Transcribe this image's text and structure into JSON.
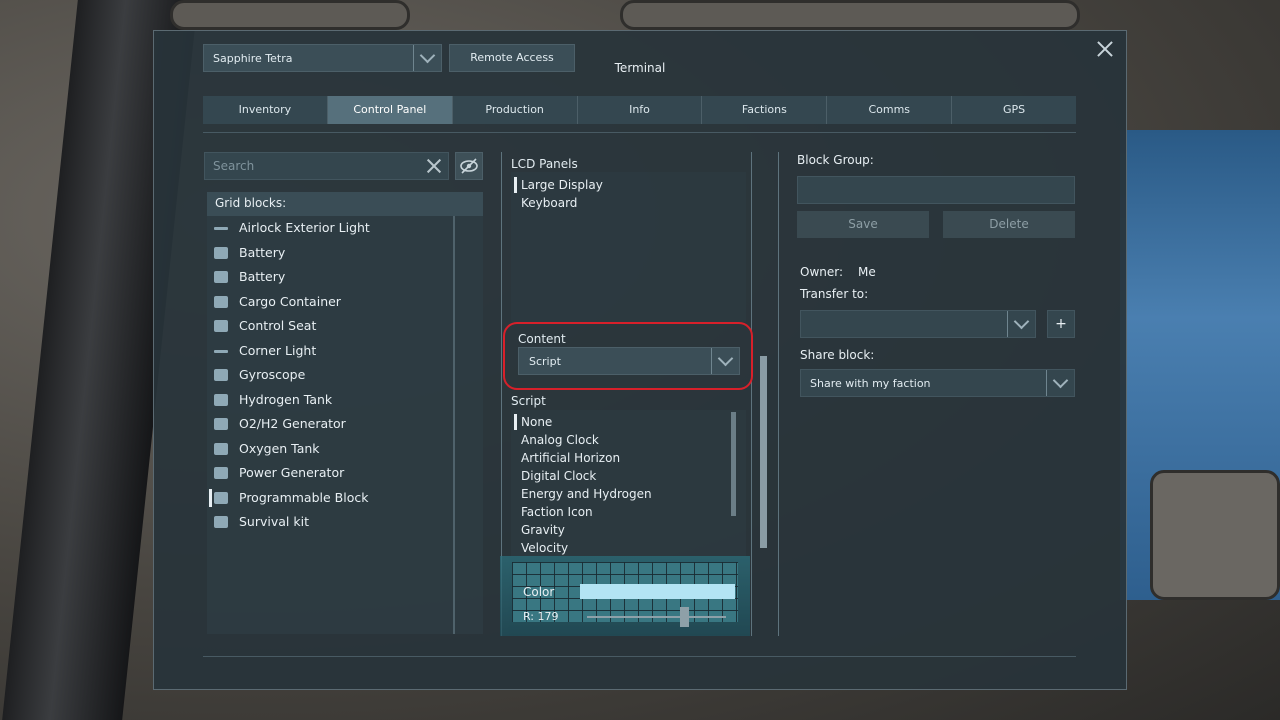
{
  "window": {
    "title": "Terminal",
    "ship_name": "Sapphire Tetra",
    "remote_access_label": "Remote Access"
  },
  "tabs": [
    {
      "label": "Inventory",
      "active": false
    },
    {
      "label": "Control Panel",
      "active": true
    },
    {
      "label": "Production",
      "active": false
    },
    {
      "label": "Info",
      "active": false
    },
    {
      "label": "Factions",
      "active": false
    },
    {
      "label": "Comms",
      "active": false
    },
    {
      "label": "GPS",
      "active": false
    }
  ],
  "left_panel": {
    "search_placeholder": "Search",
    "grid_blocks_header": "Grid blocks:",
    "items": [
      {
        "label": "Airlock Exterior Light",
        "icon": "light-strip-icon"
      },
      {
        "label": "Battery",
        "icon": "battery-icon"
      },
      {
        "label": "Battery",
        "icon": "battery-icon"
      },
      {
        "label": "Cargo Container",
        "icon": "cargo-container-icon"
      },
      {
        "label": "Control Seat",
        "icon": "control-seat-icon"
      },
      {
        "label": "Corner Light",
        "icon": "corner-light-icon"
      },
      {
        "label": "Gyroscope",
        "icon": "gyroscope-icon"
      },
      {
        "label": "Hydrogen Tank",
        "icon": "hydrogen-tank-icon"
      },
      {
        "label": "O2/H2 Generator",
        "icon": "generator-icon"
      },
      {
        "label": "Oxygen Tank",
        "icon": "oxygen-tank-icon"
      },
      {
        "label": "Power Generator",
        "icon": "power-generator-icon"
      },
      {
        "label": "Programmable Block",
        "icon": "programmable-block-icon",
        "selected": true
      },
      {
        "label": "Survival kit",
        "icon": "survival-kit-icon"
      }
    ]
  },
  "middle_panel": {
    "lcd_panels_label": "LCD Panels",
    "lcd_items": [
      {
        "label": "Large Display",
        "selected": true
      },
      {
        "label": "Keyboard",
        "selected": false
      }
    ],
    "content_label": "Content",
    "content_value": "Script",
    "script_label": "Script",
    "script_items": [
      {
        "label": "None",
        "selected": true
      },
      {
        "label": "Analog Clock",
        "selected": false
      },
      {
        "label": "Artificial Horizon",
        "selected": false
      },
      {
        "label": "Digital Clock",
        "selected": false
      },
      {
        "label": "Energy and Hydrogen",
        "selected": false
      },
      {
        "label": "Faction Icon",
        "selected": false
      },
      {
        "label": "Gravity",
        "selected": false
      },
      {
        "label": "Velocity",
        "selected": false
      }
    ],
    "color_label": "Color",
    "color_value": "#b3e4f4",
    "r_label": "R: 179",
    "r_slider_fraction": 0.7
  },
  "right_panel": {
    "block_group_label": "Block Group:",
    "block_group_value": "",
    "save_label": "Save",
    "delete_label": "Delete",
    "owner_label": "Owner:",
    "owner_value": "Me",
    "transfer_label": "Transfer to:",
    "transfer_value": "",
    "plus_label": "+",
    "share_label": "Share block:",
    "share_value": "Share with my faction"
  },
  "colors": {
    "accent_highlight": "#d8202a",
    "active_tab": "#56707c",
    "panel_bg": "#28343a"
  }
}
